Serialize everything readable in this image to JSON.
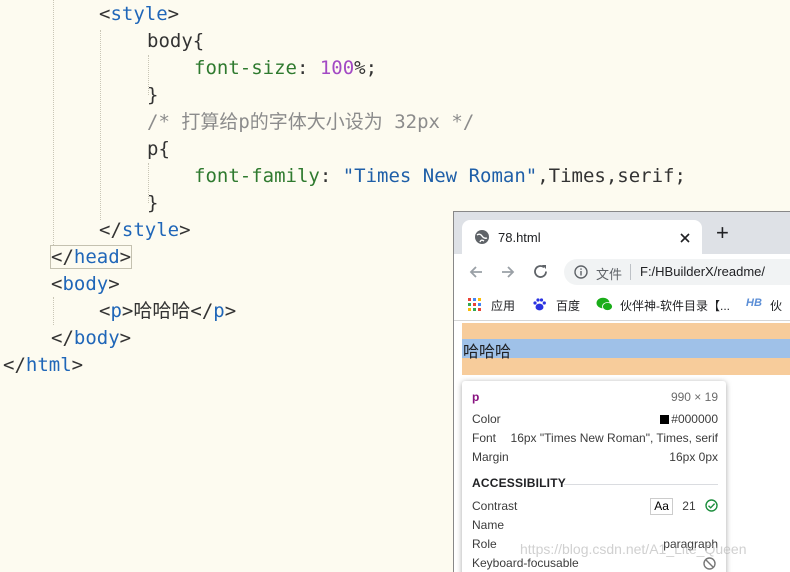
{
  "code": {
    "style_open": "style",
    "body_selector": "body{",
    "font_size_prop": "font-size",
    "font_size_value": "100",
    "font_size_unit": "%;",
    "close_brace": "}",
    "comment": "/* 打算给p的字体大小设为 32px */",
    "p_selector": "p{",
    "font_family_prop": "font-family",
    "font_family_string": "\"Times New Roman\"",
    "font_family_rest": ",Times,serif;",
    "style_close": "style",
    "head_close": "head",
    "body_open": "body",
    "p_tag": "p",
    "p_text": "哈哈哈",
    "body_close": "body",
    "html_close": "html"
  },
  "browser": {
    "tab_title": "78.html",
    "new_tab": "+",
    "address_label": "文件",
    "address_url": "F:/HBuilderX/readme/",
    "bookmarks": [
      "应用",
      "百度",
      "伙伴神-软件目录【..."
    ],
    "bookmark_cut": "伙",
    "page_text": "哈哈哈"
  },
  "inspector": {
    "tag": "p",
    "size": "990 × 19",
    "color_label": "Color",
    "color_value": "#000000",
    "font_label": "Font",
    "font_value": "16px \"Times New Roman\", Times, serif",
    "margin_label": "Margin",
    "margin_value": "16px 0px",
    "accessibility_heading": "ACCESSIBILITY",
    "contrast_label": "Contrast",
    "contrast_aa": "Aa",
    "contrast_value": "21",
    "name_label": "Name",
    "role_label": "Role",
    "role_value": "paragraph",
    "focusable_label": "Keyboard-focusable"
  },
  "watermark": "https://blog.csdn.net/A1_Lite_Queen",
  "colors": {
    "margin_band": "#f7cc9b",
    "content_band": "#9fc1e8",
    "tag_color": "#1f66b8",
    "comment_color": "#8c8c8c",
    "contrast_ok": "#1e8e3e"
  }
}
